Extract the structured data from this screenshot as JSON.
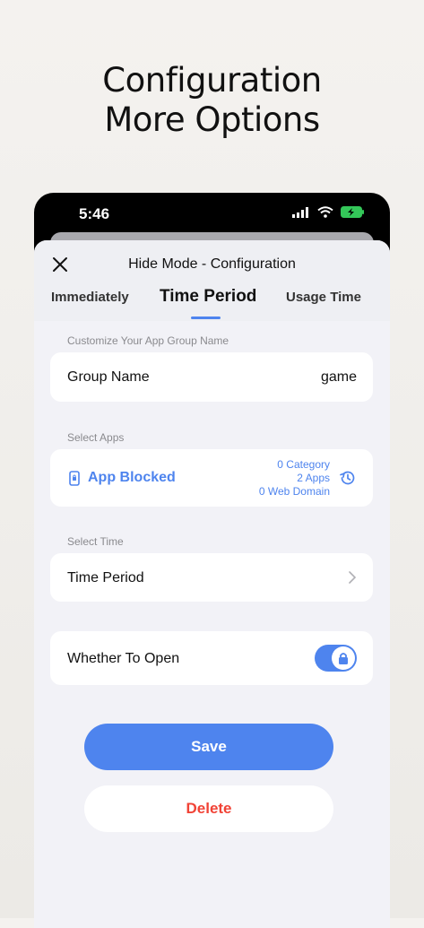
{
  "headline": {
    "line1": "Configuration",
    "line2": "More Options"
  },
  "status": {
    "time": "5:46"
  },
  "sheet": {
    "title": "Hide Mode - Configuration",
    "tabs": [
      {
        "label": "Immediately"
      },
      {
        "label": "Time Period"
      },
      {
        "label": "Usage Time"
      }
    ],
    "active_tab": "Time Period"
  },
  "group_name": {
    "section": "Customize Your App Group Name",
    "label": "Group Name",
    "value": "game"
  },
  "apps": {
    "section": "Select Apps",
    "title": "App Blocked",
    "summary": [
      "0 Category",
      "2 Apps",
      "0 Web Domain"
    ]
  },
  "time": {
    "section": "Select Time",
    "label": "Time Period"
  },
  "open": {
    "label": "Whether To Open",
    "toggle_on": true
  },
  "buttons": {
    "save": "Save",
    "delete": "Delete"
  },
  "colors": {
    "accent": "#4e84ee",
    "danger": "#f14336",
    "background": "#f2f2f7"
  },
  "icons": [
    "close-icon",
    "signal-icon",
    "wifi-icon",
    "battery-charging-icon",
    "phone-lock-icon",
    "history-icon",
    "chevron-right-icon",
    "lock-icon"
  ]
}
